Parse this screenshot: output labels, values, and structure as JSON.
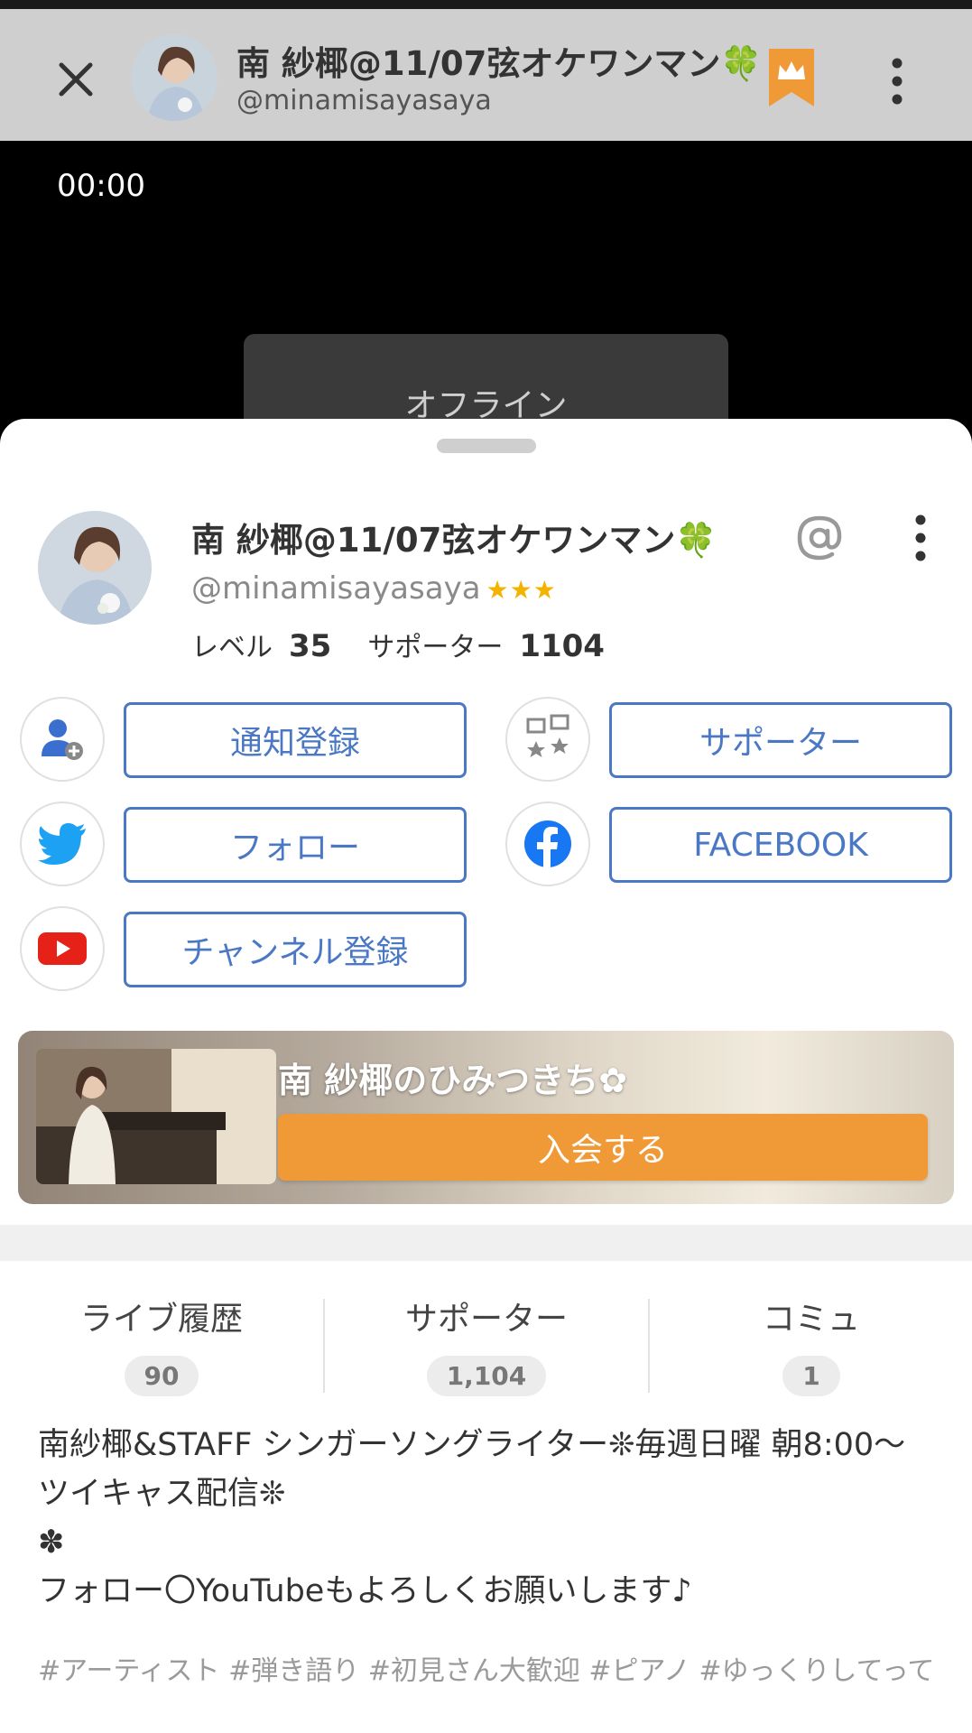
{
  "header": {
    "name": "南 紗椰@11/07弦オケワンマン🍀",
    "handle": "@minamisayasaya"
  },
  "video": {
    "timer": "00:00",
    "status": "オフライン"
  },
  "profile": {
    "name": "南 紗椰@11/07弦オケワンマン🍀",
    "handle": "@minamisayasaya",
    "stars": "★★★",
    "level_label": "レベル",
    "level": "35",
    "supporter_label": "サポーター",
    "supporter_count": "1104"
  },
  "actions": {
    "notify": "通知登録",
    "supporter": "サポーター",
    "follow": "フォロー",
    "facebook": "FACEBOOK",
    "channel": "チャンネル登録"
  },
  "fanclub": {
    "title": "南 紗椰のひみつきち✿",
    "join": "入会する"
  },
  "stats": [
    {
      "label": "ライブ履歴",
      "count": "90"
    },
    {
      "label": "サポーター",
      "count": "1,104"
    },
    {
      "label": "コミュ",
      "count": "1"
    }
  ],
  "bio": {
    "line1": "南紗椰&STAFF シンガーソングライター❊毎週日曜 朝8:00〜",
    "line2": "ツイキャス配信❊",
    "line3": "✽",
    "line4": "フォロー〇YouTubeもよろしくお願いします♪"
  },
  "tags": "#アーティスト #弾き語り #初見さん大歓迎 #ピアノ #ゆっくりしてって",
  "colors": {
    "accent_blue": "#4a78c4",
    "join_orange": "#ef9a36",
    "crown_orange": "#ef9a36",
    "star_gold": "#f2b400"
  }
}
